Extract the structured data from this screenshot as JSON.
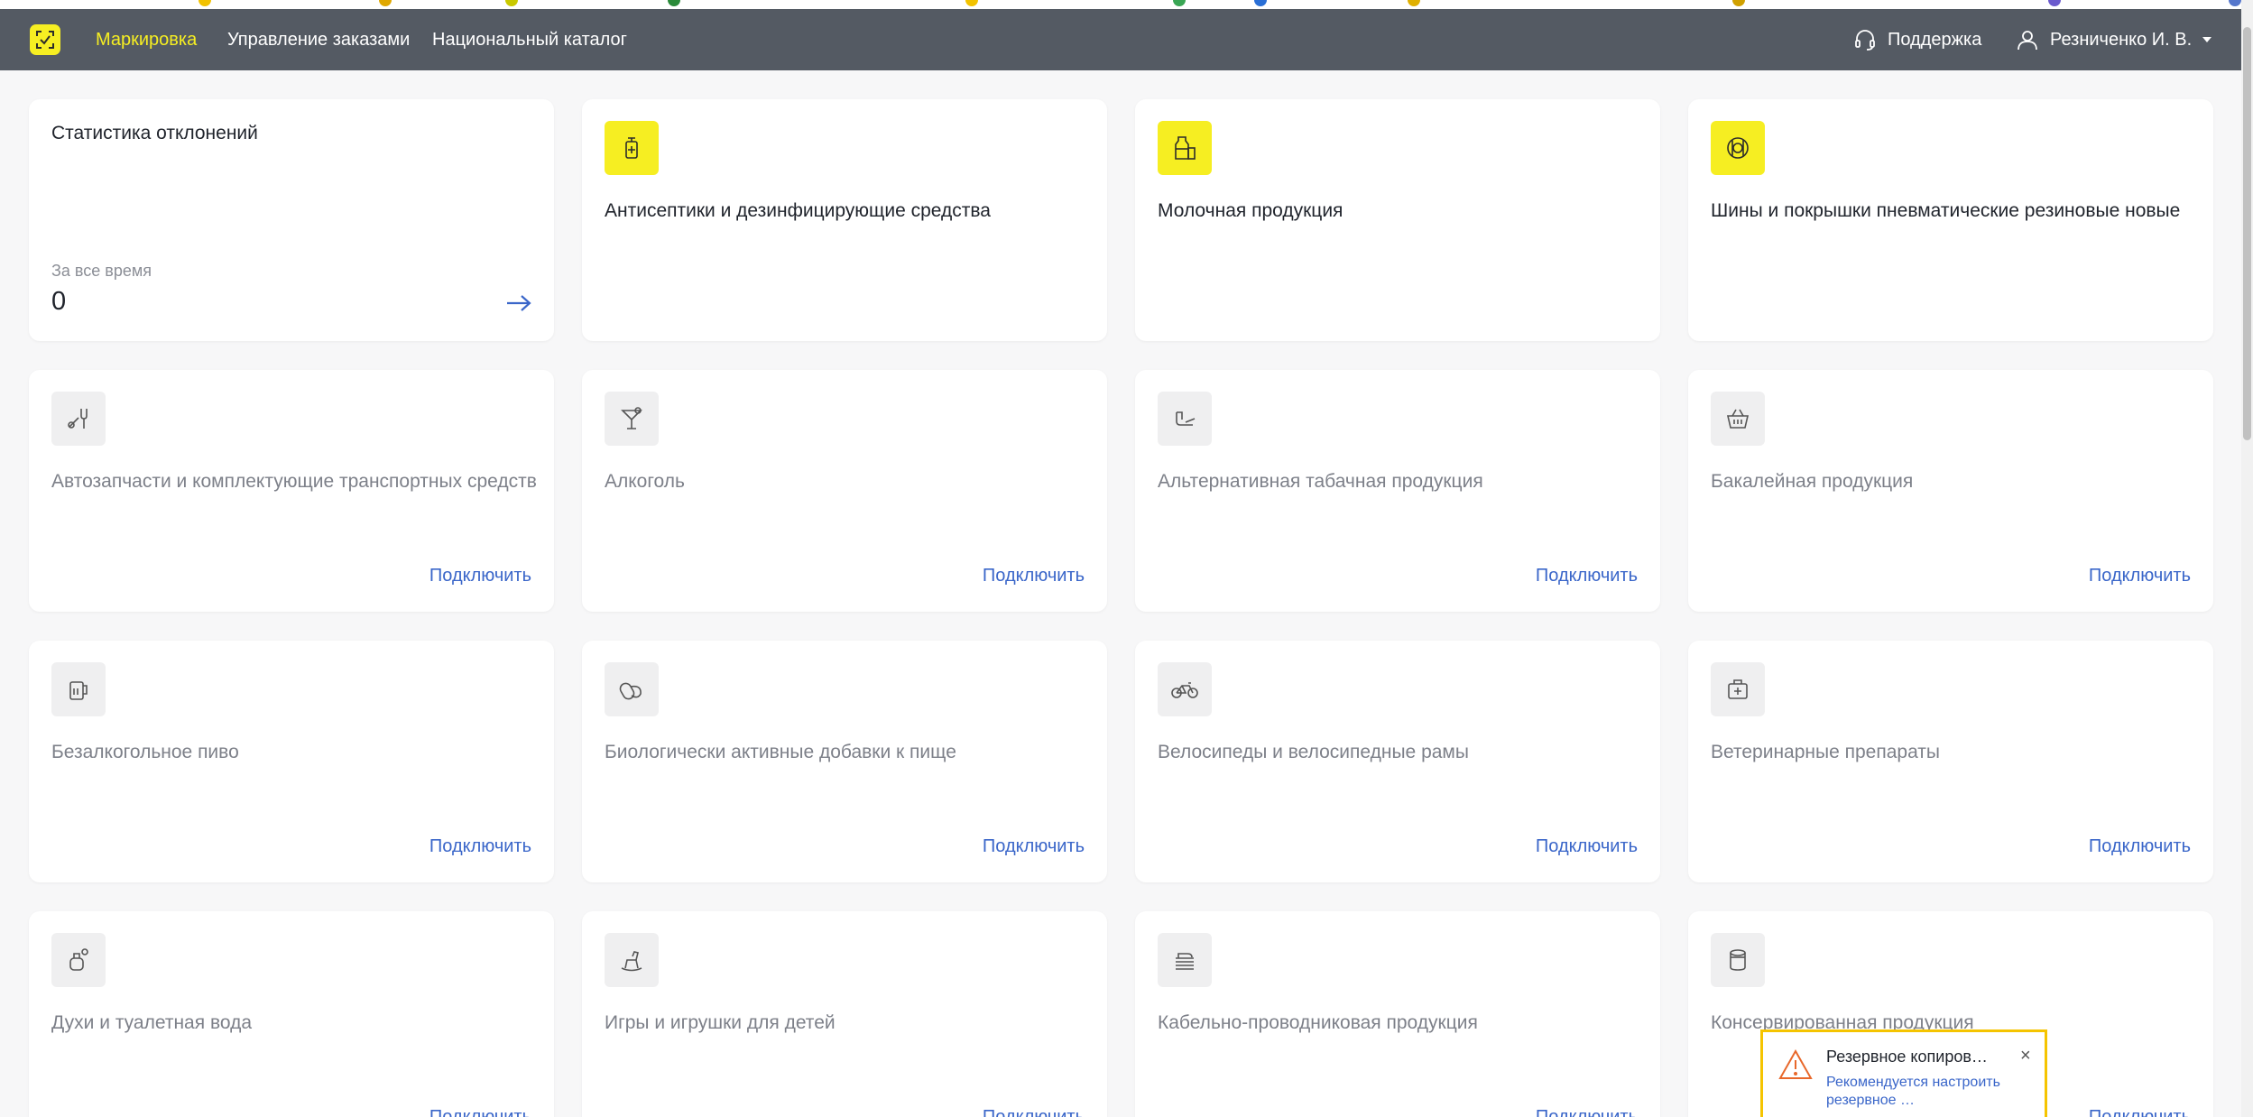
{
  "colors": {
    "navbar": "#545a63",
    "accent_yellow": "#f6ee22",
    "link_blue": "#3a66c9",
    "toast_border": "#f5c400"
  },
  "navbar": {
    "logo_icon": "marking-logo-icon",
    "links": [
      {
        "label": "Маркировка",
        "active": true
      },
      {
        "label": "Управление заказами",
        "active": false
      },
      {
        "label": "Национальный каталог",
        "active": false
      }
    ],
    "support_label": "Поддержка",
    "user_label": "Резниченко И. В."
  },
  "stats_card": {
    "title": "Статистика отклонений",
    "period": "За все время",
    "value": "0"
  },
  "connect_label": "Подключить",
  "product_groups": [
    {
      "name": "Антисептики и дезинфицирующие средства",
      "icon": "antiseptic-icon",
      "connected": true
    },
    {
      "name": "Молочная продукция",
      "icon": "milk-icon",
      "connected": true
    },
    {
      "name": "Шины и покрышки пневматические резиновые новые",
      "icon": "tire-icon",
      "connected": true
    },
    {
      "name": "Автозапчасти и комплектующие транспортных средств",
      "icon": "wrench-icon",
      "connected": false
    },
    {
      "name": "Алкоголь",
      "icon": "cocktail-icon",
      "connected": false
    },
    {
      "name": "Альтернативная табачная продукция",
      "icon": "pipe-icon",
      "connected": false
    },
    {
      "name": "Бакалейная продукция",
      "icon": "basket-icon",
      "connected": false
    },
    {
      "name": "Безалкогольное пиво",
      "icon": "beer-mug-icon",
      "connected": false
    },
    {
      "name": "Биологически активные добавки к пище",
      "icon": "supplement-icon",
      "connected": false
    },
    {
      "name": "Велосипеды и велосипедные рамы",
      "icon": "bicycle-icon",
      "connected": false
    },
    {
      "name": "Ветеринарные препараты",
      "icon": "vet-kit-icon",
      "connected": false
    },
    {
      "name": "Духи и туалетная вода",
      "icon": "perfume-icon",
      "connected": false
    },
    {
      "name": "Игры и игрушки для детей",
      "icon": "rocking-horse-icon",
      "connected": false
    },
    {
      "name": "Кабельно-проводниковая продукция",
      "icon": "cable-icon",
      "connected": false
    },
    {
      "name": "Консервированная продукция",
      "icon": "can-icon",
      "connected": false
    }
  ],
  "toast": {
    "title": "Резервное копиров…",
    "text": "Рекомендуется настроить резервное …",
    "close": "×"
  }
}
